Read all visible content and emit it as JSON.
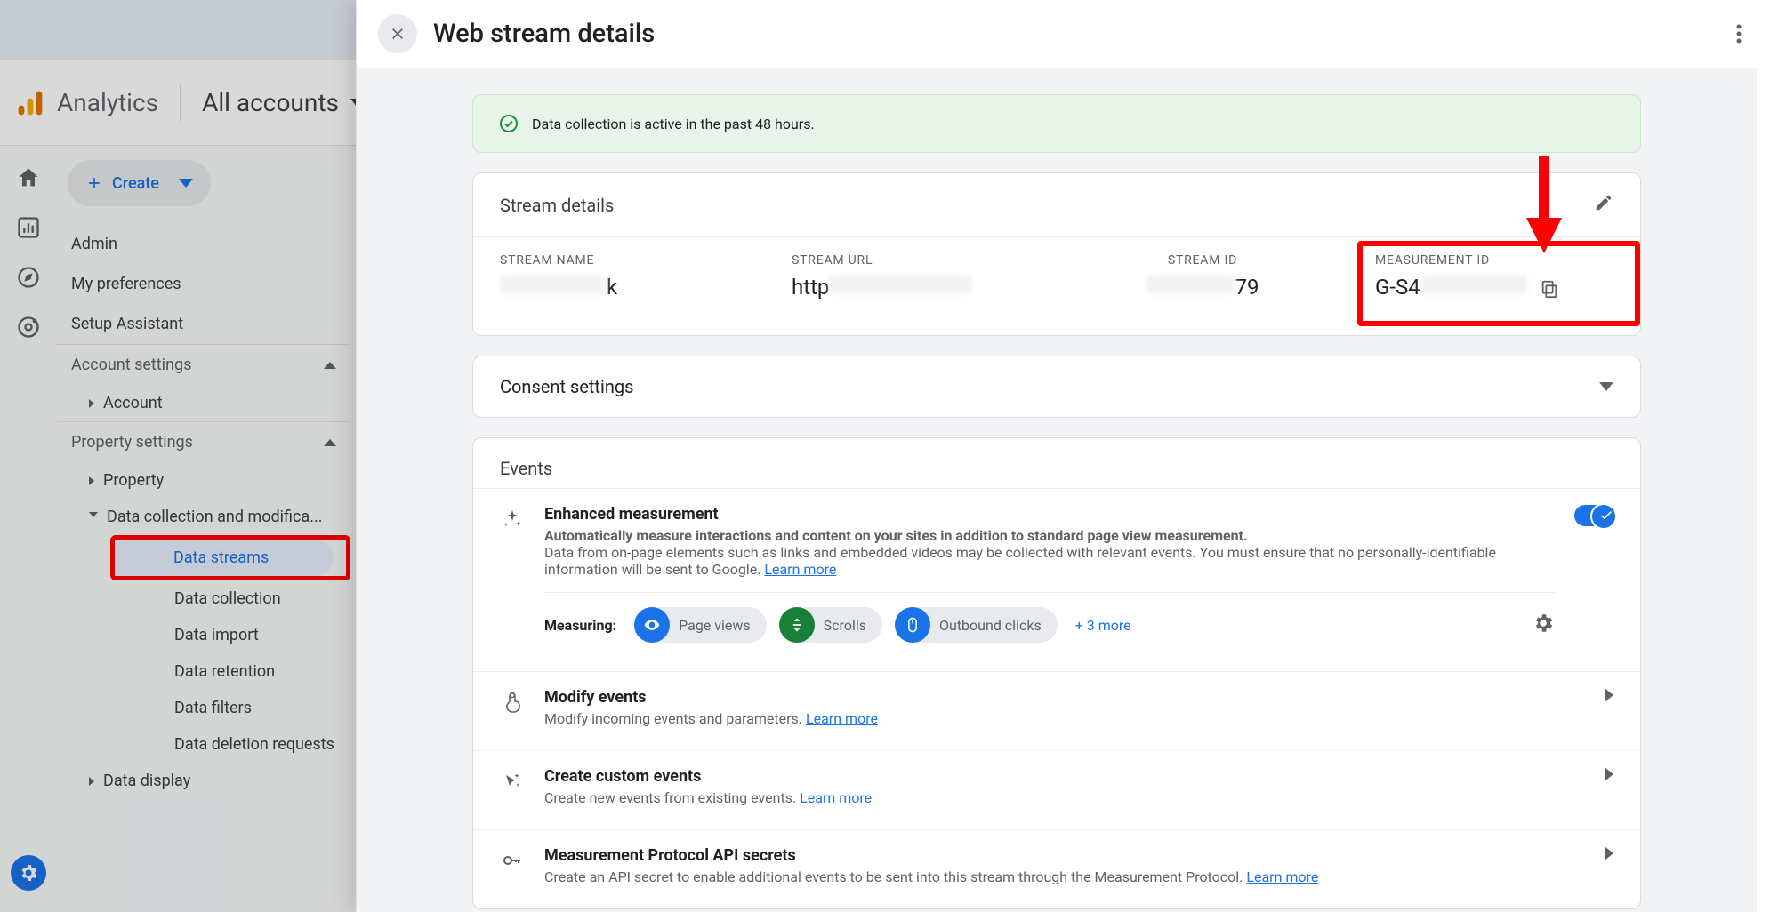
{
  "header": {
    "product": "Analytics",
    "accounts": "All accounts"
  },
  "sidebar": {
    "create": "Create",
    "items": [
      "Admin",
      "My preferences",
      "Setup Assistant"
    ],
    "account_section": "Account settings",
    "account_item": "Account",
    "property_section": "Property settings",
    "property_item": "Property",
    "data_mod_item": "Data collection and modifica...",
    "leaf_items": [
      "Data streams",
      "Data collection",
      "Data import",
      "Data retention",
      "Data filters",
      "Data deletion requests"
    ],
    "data_display_item": "Data display"
  },
  "panel": {
    "title": "Web stream details",
    "status": "Data collection is active in the past 48 hours.",
    "stream_details_title": "Stream details",
    "labels": {
      "name": "STREAM NAME",
      "url": "STREAM URL",
      "id": "STREAM ID",
      "measurement": "MEASUREMENT ID"
    },
    "values": {
      "name_suffix": "k",
      "url_prefix": "http",
      "id_suffix": "79",
      "measurement_prefix": "G-S4"
    },
    "consent": "Consent settings",
    "events_title": "Events",
    "enhanced": {
      "title": "Enhanced measurement",
      "line1": "Automatically measure interactions and content on your sites in addition to standard page view measurement.",
      "line2": "Data from on-page elements such as links and embedded videos may be collected with relevant events. You must ensure that no personally-identifiable information will be sent to Google.",
      "learn": "Learn more",
      "measuring": "Measuring:",
      "pills": [
        "Page views",
        "Scrolls",
        "Outbound clicks"
      ],
      "more": "+ 3 more"
    },
    "modify": {
      "title": "Modify events",
      "desc": "Modify incoming events and parameters.",
      "learn": "Learn more"
    },
    "custom": {
      "title": "Create custom events",
      "desc": "Create new events from existing events.",
      "learn": "Learn more"
    },
    "api": {
      "title": "Measurement Protocol API secrets",
      "desc": "Create an API secret to enable additional events to be sent into this stream through the Measurement Protocol.",
      "learn": "Learn more"
    }
  }
}
